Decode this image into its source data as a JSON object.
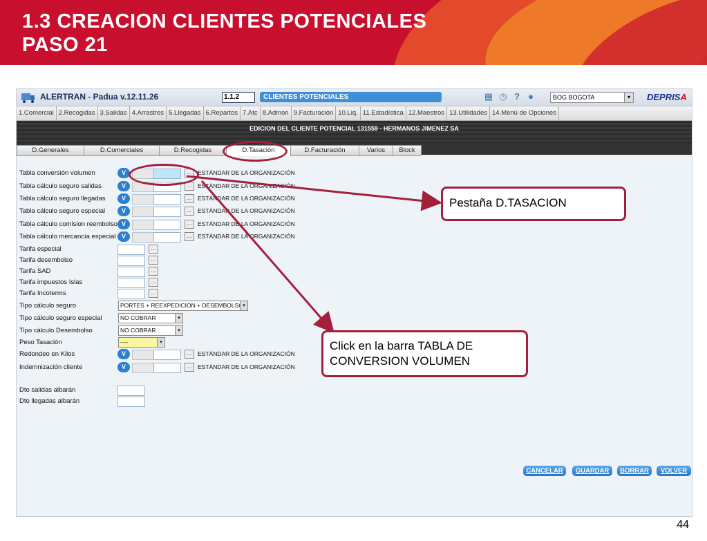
{
  "slide": {
    "title_line1": "1.3 CREACION CLIENTES POTENCIALES",
    "title_line2": "PASO 21",
    "page_number": "44"
  },
  "app": {
    "name": "ALERTRAN - Padua  v.12.11.26",
    "screen_code": "1.1.2",
    "screen_title": "CLIENTES POTENCIALES",
    "office_select": "BOG BOGOTA",
    "brand_main": "DEPRIS",
    "brand_accent": "A",
    "menu": [
      "1.Comercial",
      "2.Recogidas",
      "3.Salidas",
      "4.Arrastres",
      "5.Llegadas",
      "6.Repartos",
      "7.Atc",
      "8.Admon",
      "9.Facturación",
      "10.Liq.",
      "11.Estadística",
      "12.Maestros",
      "13.Utilidades",
      "14.Menú de Opciones"
    ],
    "record_title": "EDICION DEL CLIENTE POTENCIAL 131559 - HERMANOS JIMENEZ SA",
    "tabs": [
      "D.Generales",
      "D.Comerciales",
      "D.Recogidas",
      "D.Tasación",
      "D.Facturación",
      "Varios",
      "Block"
    ],
    "active_tab": "D.Tasación"
  },
  "form": {
    "v_label": "V",
    "dots": "...",
    "std": "ESTÁNDAR DE LA ORGANIZACIÓN",
    "rows": [
      "Tabla conversión volumen",
      "Tabla cálculo seguro salidas",
      "Tabla cálculo seguro llegadas",
      "Tabla cálculo seguro especial",
      "Tabla cálculo comision reembolso",
      "Tabla cálculo mercancía especial",
      "Tarifa especial",
      "Tarifa desembolso",
      "Tarifa SAD",
      "Tarifa impuestos Islas",
      "Tarifa Incoterms",
      "Tipo cálculo seguro",
      "Tipo cálculo seguro especial",
      "Tipo cálculo Desembolso",
      "Peso Tasación",
      "Redondeo en Kilos",
      "Indemnización cliente",
      "Dto salidas albarán",
      "Dto llegadas albarán"
    ],
    "tipo_calculo_seguro": "PORTES + REEXPEDICION + DESEMBOLSO",
    "tipo_calculo_seguro_especial": "NO COBRAR",
    "tipo_calculo_desembolso": "NO COBRAR",
    "peso_tasacion": "----"
  },
  "buttons": {
    "cancelar": "CANCELAR",
    "guardar": "GUARDAR",
    "borrar": "BORRAR",
    "volver": "VOLVER"
  },
  "callouts": {
    "tab_note": "Pestaña D.TASACION",
    "click_note_line1": "Click en la barra TABLA DE",
    "click_note_line2": "CONVERSION VOLUMEN"
  },
  "colors": {
    "header_red": "#c8102e",
    "callout_border": "#a31f3c",
    "button_blue": "#2574c4"
  }
}
